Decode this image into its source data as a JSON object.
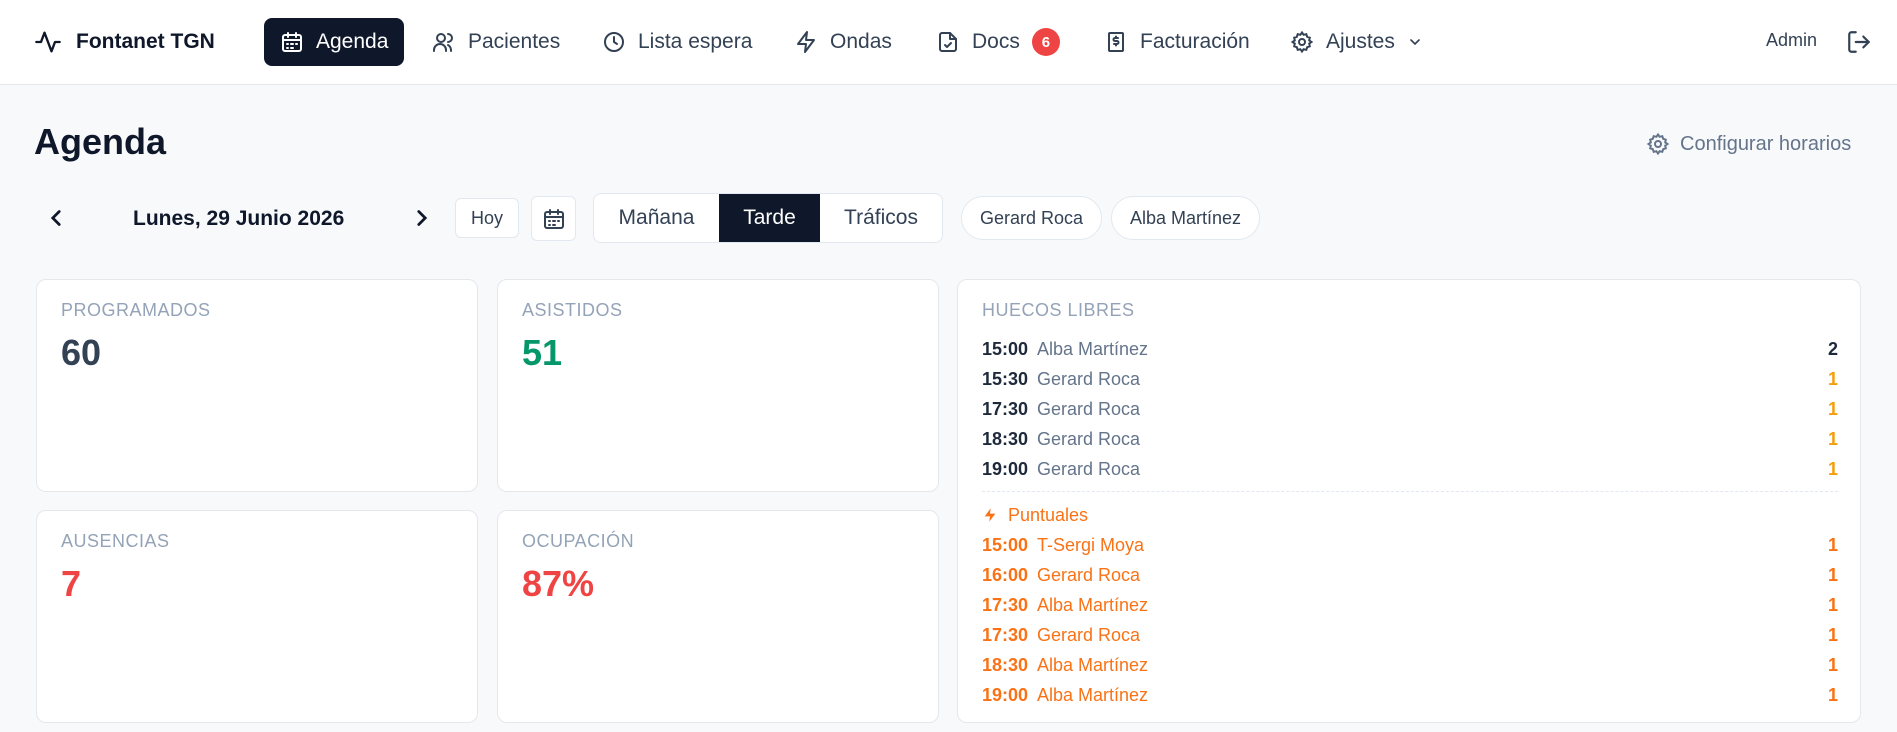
{
  "brand": {
    "name": "Fontanet TGN",
    "icon": "activity-icon"
  },
  "nav": [
    {
      "label": "Agenda",
      "icon": "calendar-icon",
      "active": true
    },
    {
      "label": "Pacientes",
      "icon": "users-icon",
      "active": false
    },
    {
      "label": "Lista espera",
      "icon": "clock-icon",
      "active": false
    },
    {
      "label": "Ondas",
      "icon": "bolt-icon",
      "active": false
    },
    {
      "label": "Docs",
      "icon": "file-check-icon",
      "active": false,
      "badge": "6"
    },
    {
      "label": "Facturación",
      "icon": "receipt-icon",
      "active": false
    },
    {
      "label": "Ajustes",
      "icon": "gear-icon",
      "active": false
    }
  ],
  "user": {
    "name": "Admin"
  },
  "page": {
    "title": "Agenda",
    "config_label": "Configurar horarios"
  },
  "toolbar": {
    "date": "Lunes, 29 Junio 2026",
    "today_label": "Hoy",
    "shifts": [
      {
        "label": "Mañana",
        "active": false
      },
      {
        "label": "Tarde",
        "active": true
      },
      {
        "label": "Tráficos",
        "active": false
      }
    ],
    "professionals": [
      "Gerard Roca",
      "Alba Martínez"
    ]
  },
  "stats": [
    {
      "label": "PROGRAMADOS",
      "value": "60",
      "color": "#334155"
    },
    {
      "label": "ASISTIDOS",
      "value": "51",
      "color": "#059669"
    },
    {
      "label": "AUSENCIAS",
      "value": "7",
      "color": "#ef4444"
    },
    {
      "label": "OCUPACIÓN",
      "value": "87%",
      "color": "#ef4444"
    }
  ],
  "huecos": {
    "title": "HUECOS LIBRES",
    "slots": [
      {
        "time": "15:00",
        "name": "Alba Martínez",
        "count": "2",
        "count_color": "#1e293b"
      },
      {
        "time": "15:30",
        "name": "Gerard Roca",
        "count": "1",
        "count_color": "#f59e0b"
      },
      {
        "time": "17:30",
        "name": "Gerard Roca",
        "count": "1",
        "count_color": "#f59e0b"
      },
      {
        "time": "18:30",
        "name": "Gerard Roca",
        "count": "1",
        "count_color": "#f59e0b"
      },
      {
        "time": "19:00",
        "name": "Gerard Roca",
        "count": "1",
        "count_color": "#f59e0b"
      }
    ],
    "puntuales_label": "Puntuales",
    "puntuales": [
      {
        "time": "15:00",
        "name": "T-Sergi Moya",
        "count": "1"
      },
      {
        "time": "16:00",
        "name": "Gerard Roca",
        "count": "1"
      },
      {
        "time": "17:30",
        "name": "Alba Martínez",
        "count": "1"
      },
      {
        "time": "17:30",
        "name": "Gerard Roca",
        "count": "1"
      },
      {
        "time": "18:30",
        "name": "Alba Martínez",
        "count": "1"
      },
      {
        "time": "19:00",
        "name": "Alba Martínez",
        "count": "1"
      }
    ]
  },
  "colors": {
    "accent": "#0f172a",
    "orange": "#f97316",
    "green": "#059669",
    "red": "#ef4444"
  }
}
